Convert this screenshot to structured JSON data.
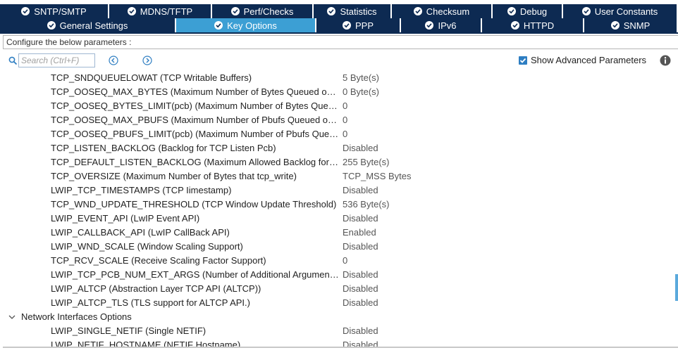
{
  "tabs_row1": [
    {
      "label": "SNTP/SMTP",
      "w": 155
    },
    {
      "label": "MDNS/TFTP",
      "w": 146
    },
    {
      "label": "Perf/Checks",
      "w": 144
    },
    {
      "label": "Statistics",
      "w": 111
    },
    {
      "label": "Checksum",
      "w": 143
    },
    {
      "label": "Debug",
      "w": 100
    },
    {
      "label": "User Constants",
      "w": 163
    }
  ],
  "tabs_row2": [
    {
      "label": "General Settings",
      "w": 250,
      "active": false
    },
    {
      "label": "Key Options",
      "w": 199,
      "active": true
    },
    {
      "label": "PPP",
      "w": 120,
      "active": false
    },
    {
      "label": "IPv6",
      "w": 115,
      "active": false
    },
    {
      "label": "HTTPD",
      "w": 145,
      "active": false
    },
    {
      "label": "SNMP",
      "w": 133,
      "active": false
    }
  ],
  "config_header": "Configure the below parameters :",
  "search": {
    "placeholder": "Search (Ctrl+F)"
  },
  "advanced": {
    "label": "Show Advanced Parameters",
    "checked": true
  },
  "parameters": [
    {
      "name": "TCP_SNDQUEUELOWAT (TCP Writable Buffers)",
      "value": "5 Byte(s)"
    },
    {
      "name": "TCP_OOSEQ_MAX_BYTES (Maximum Number of Bytes Queued on…",
      "value": "0 Byte(s)"
    },
    {
      "name": "TCP_OOSEQ_BYTES_LIMIT(pcb) (Maximum Number of Bytes Queu…",
      "value": "0"
    },
    {
      "name": "TCP_OOSEQ_MAX_PBUFS (Maximum Number of Pbufs Queued on…",
      "value": "0"
    },
    {
      "name": "TCP_OOSEQ_PBUFS_LIMIT(pcb) (Maximum Number of Pbufs Queu…",
      "value": "0"
    },
    {
      "name": "TCP_LISTEN_BACKLOG (Backlog for TCP Listen Pcb)",
      "value": "Disabled"
    },
    {
      "name": "TCP_DEFAULT_LISTEN_BACKLOG (Maximum Allowed Backlog for …",
      "value": "255 Byte(s)"
    },
    {
      "name": "TCP_OVERSIZE (Maximum Number of Bytes that tcp_write)",
      "value": "TCP_MSS Bytes"
    },
    {
      "name": "LWIP_TCP_TIMESTAMPS (TCP Iimestamp)",
      "value": "Disabled"
    },
    {
      "name": "TCP_WND_UPDATE_THRESHOLD (TCP Window Update Threshold)",
      "value": "536 Byte(s)"
    },
    {
      "name": "LWIP_EVENT_API (LwIP Event API)",
      "value": "Disabled"
    },
    {
      "name": "LWIP_CALLBACK_API (LwIP CallBack API)",
      "value": "Enabled"
    },
    {
      "name": "LWIP_WND_SCALE (Window Scaling Support)",
      "value": "Disabled"
    },
    {
      "name": "TCP_RCV_SCALE (Receive Scaling Factor Support)",
      "value": "0"
    },
    {
      "name": "LWIP_TCP_PCB_NUM_EXT_ARGS (Number of Additional Argument…",
      "value": "Disabled"
    },
    {
      "name": "LWIP_ALTCP (Abstraction Layer TCP API (ALTCP))",
      "value": "Disabled"
    },
    {
      "name": "LWIP_ALTCP_TLS (TLS support for ALTCP API.)",
      "value": "Disabled"
    }
  ],
  "group": {
    "name": "Network Interfaces Options",
    "expanded": true
  },
  "group_parameters": [
    {
      "name": "LWIP_SINGLE_NETIF (Single NETIF)",
      "value": "Disabled"
    },
    {
      "name": "LWIP_NETIF_HOSTNAME (NETIF Hostname)",
      "value": "Disabled"
    }
  ],
  "colors": {
    "tab_bg": "#0d2a52",
    "tab_active": "#3c9fd4",
    "accent": "#2e7ec2"
  }
}
